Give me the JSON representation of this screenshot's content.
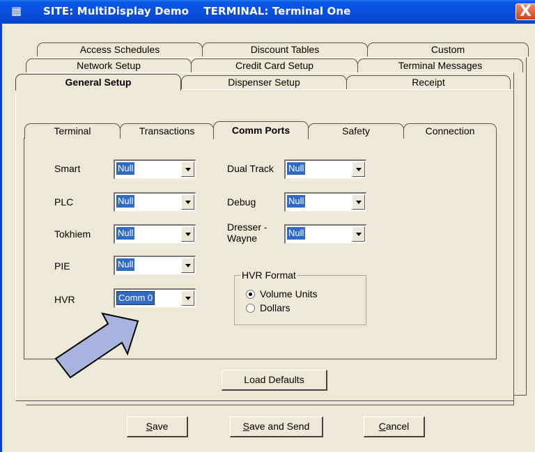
{
  "window": {
    "title": "SITE: MultiDisplay Demo    TERMINAL: Terminal One",
    "close_label": "X"
  },
  "outer_tabs": {
    "row1": [
      "Access Schedules",
      "Discount Tables",
      "Custom"
    ],
    "row2": [
      "Network Setup",
      "Credit Card Setup",
      "Terminal Messages"
    ],
    "row3": [
      "General Setup",
      "Dispenser Setup",
      "Receipt"
    ],
    "selected": "General Setup"
  },
  "inner_tabs": {
    "items": [
      "Terminal",
      "Transactions",
      "Comm Ports",
      "Safety",
      "Connection"
    ],
    "selected": "Comm Ports"
  },
  "ports_left": [
    {
      "label": "Smart",
      "value": "Null"
    },
    {
      "label": "PLC",
      "value": "Null"
    },
    {
      "label": "Tokhiem",
      "value": "Null"
    },
    {
      "label": "PIE",
      "value": "Null"
    },
    {
      "label": "HVR",
      "value": "Comm 0"
    }
  ],
  "ports_right": [
    {
      "label": "Dual Track",
      "value": "Null"
    },
    {
      "label": "Debug",
      "value": "Null"
    },
    {
      "label_line1": "Dresser -",
      "label_line2": "Wayne",
      "value": "Null"
    }
  ],
  "hvr_format": {
    "legend": "HVR Format",
    "options": [
      "Volume Units",
      "Dollars"
    ],
    "selected": "Volume Units"
  },
  "buttons": {
    "load_defaults": "Load Defaults",
    "save_first": "S",
    "save_rest": "ave",
    "save_send_first": "S",
    "save_send_rest": "ave and Send",
    "cancel_first": "C",
    "cancel_rest": "ancel"
  },
  "colors": {
    "titlebar": "#0b4ddc",
    "selection": "#316ac5",
    "pointer_arrow": "#a8b4de"
  }
}
